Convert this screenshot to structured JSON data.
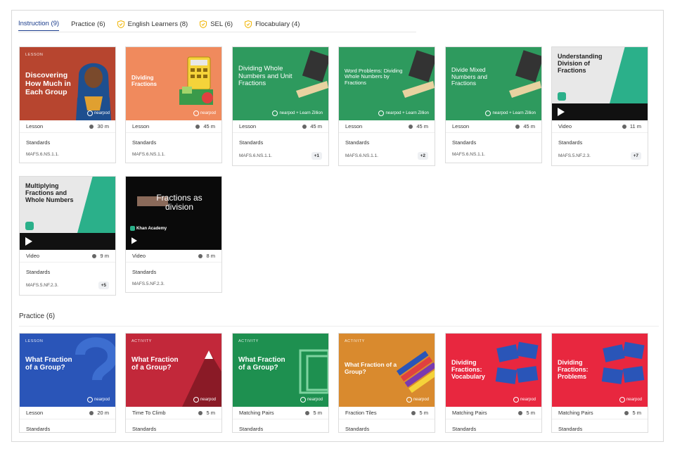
{
  "tabs": [
    {
      "label": "Instruction (9)",
      "active": true,
      "icon": ""
    },
    {
      "label": "Practice (6)",
      "active": false,
      "icon": ""
    },
    {
      "label": "English Learners (8)",
      "active": false,
      "icon": "shield-icon"
    },
    {
      "label": "SEL (6)",
      "active": false,
      "icon": "shield-icon"
    },
    {
      "label": "Flocabulary (4)",
      "active": false,
      "icon": "shield-icon"
    }
  ],
  "practice_section_title": "Practice (6)",
  "common": {
    "standards_label": "Standards"
  },
  "instruction_cards": [
    {
      "kicker": "LESSON",
      "title": "Discovering How Much in Each Group",
      "brand": "nearpod",
      "type": "Lesson",
      "duration": "30 m",
      "standard": "MAFS.6.NS.1.1.",
      "extra": ""
    },
    {
      "kicker": "",
      "title": "Dividing Fractions",
      "brand": "nearpod",
      "type": "Lesson",
      "duration": "45 m",
      "standard": "MAFS.6.NS.1.1.",
      "extra": ""
    },
    {
      "kicker": "",
      "title": "Dividing Whole Numbers and Unit Fractions",
      "brand": "nearpod + Learn Zillion",
      "type": "Lesson",
      "duration": "45 m",
      "standard": "MAFS.6.NS.1.1.",
      "extra": "+1"
    },
    {
      "kicker": "",
      "title": "Word Problems: Dividing Whole Numbers by Fractions",
      "brand": "nearpod + Learn Zillion",
      "type": "Lesson",
      "duration": "45 m",
      "standard": "MAFS.6.NS.1.1.",
      "extra": "+2"
    },
    {
      "kicker": "",
      "title": "Divide Mixed Numbers and Fractions",
      "brand": "nearpod + Learn Zillion",
      "type": "Lesson",
      "duration": "45 m",
      "standard": "MAFS.6.NS.1.1.",
      "extra": ""
    },
    {
      "kicker": "",
      "title": "Understanding Division of Fractions",
      "brand": "",
      "type": "Video",
      "duration": "11 m",
      "standard": "MAFS.5.NF.2.3.",
      "extra": "+7"
    },
    {
      "kicker": "",
      "title": "Multiplying Fractions and Whole Numbers",
      "brand": "",
      "type": "Video",
      "duration": "9 m",
      "standard": "MAFS.5.NF.2.3.",
      "extra": "+5"
    },
    {
      "kicker": "",
      "title": "Fractions as division",
      "brand": "Khan Academy",
      "type": "Video",
      "duration": "8 m",
      "standard": "MAFS.5.NF.2.3.",
      "extra": ""
    }
  ],
  "practice_cards": [
    {
      "kicker": "LESSON",
      "title": "What Fraction of a Group?",
      "brand": "nearpod",
      "type": "Lesson",
      "duration": "20 m"
    },
    {
      "kicker": "ACTIVITY",
      "title": "What Fraction of a Group?",
      "brand": "nearpod",
      "type": "Time To Climb",
      "duration": "5 m"
    },
    {
      "kicker": "ACTIVITY",
      "title": "What Fraction of a Group?",
      "brand": "nearpod",
      "type": "Matching Pairs",
      "duration": "5 m"
    },
    {
      "kicker": "ACTIVITY",
      "title": "What Fraction of a Group?",
      "brand": "nearpod",
      "type": "Fraction Tiles",
      "duration": "5 m"
    },
    {
      "kicker": "",
      "title": "Dividing Fractions: Vocabulary",
      "brand": "nearpod",
      "type": "Matching Pairs",
      "duration": "5 m"
    },
    {
      "kicker": "",
      "title": "Dividing Fractions: Problems",
      "brand": "nearpod",
      "type": "Matching Pairs",
      "duration": "5 m"
    }
  ],
  "colors": {
    "accent": "#1a3c8c",
    "shield": "#f0b400",
    "green": "#2e9a5e",
    "lesson_red": "#b7452f",
    "orange": "#f08a5d",
    "blue": "#2a55b8",
    "activity_red": "#c2283a",
    "amber": "#d98a2e",
    "pink_red": "#e8273f"
  }
}
